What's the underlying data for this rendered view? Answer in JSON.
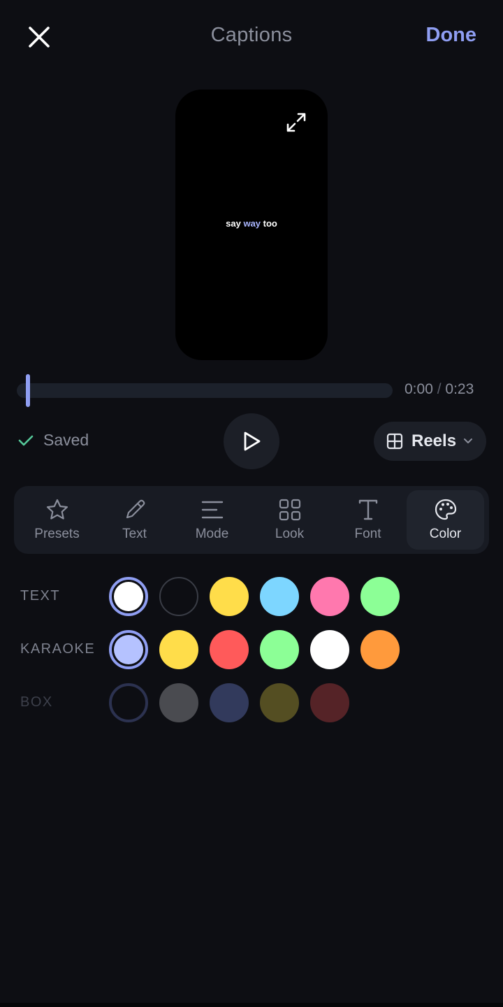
{
  "header": {
    "title": "Captions",
    "done_label": "Done"
  },
  "preview": {
    "caption_before": "say ",
    "caption_highlight": "way",
    "caption_after": " too"
  },
  "timeline": {
    "progress": 0.0,
    "current": "0:00",
    "separator": "/",
    "total": "0:23"
  },
  "controls": {
    "saved_label": "Saved",
    "format_label": "Reels"
  },
  "tabs": [
    {
      "label": "Presets",
      "icon": "star-icon"
    },
    {
      "label": "Text",
      "icon": "pencil-icon"
    },
    {
      "label": "Mode",
      "icon": "lines-icon"
    },
    {
      "label": "Look",
      "icon": "grid-icon"
    },
    {
      "label": "Font",
      "icon": "font-t-icon"
    },
    {
      "label": "Color",
      "icon": "palette-icon",
      "active": true
    }
  ],
  "colors": {
    "text": {
      "label": "TEXT",
      "selected": 0,
      "swatches": [
        "#ffffff",
        "transparent",
        "#ffdd4a",
        "#7dd6ff",
        "#ff78ae",
        "#8cff96"
      ]
    },
    "karaoke": {
      "label": "KARAOKE",
      "selected": 0,
      "swatches": [
        "#b5c2ff",
        "#ffdd4a",
        "#ff5a5a",
        "#8cff96",
        "#ffffff",
        "#ff9a3c"
      ]
    },
    "box": {
      "label": "BOX",
      "selected": 0,
      "swatches": [
        "transparent",
        "#4a4b50",
        "#323a5c",
        "#544e22",
        "#552327"
      ]
    }
  },
  "accent": "#8f9ef2"
}
